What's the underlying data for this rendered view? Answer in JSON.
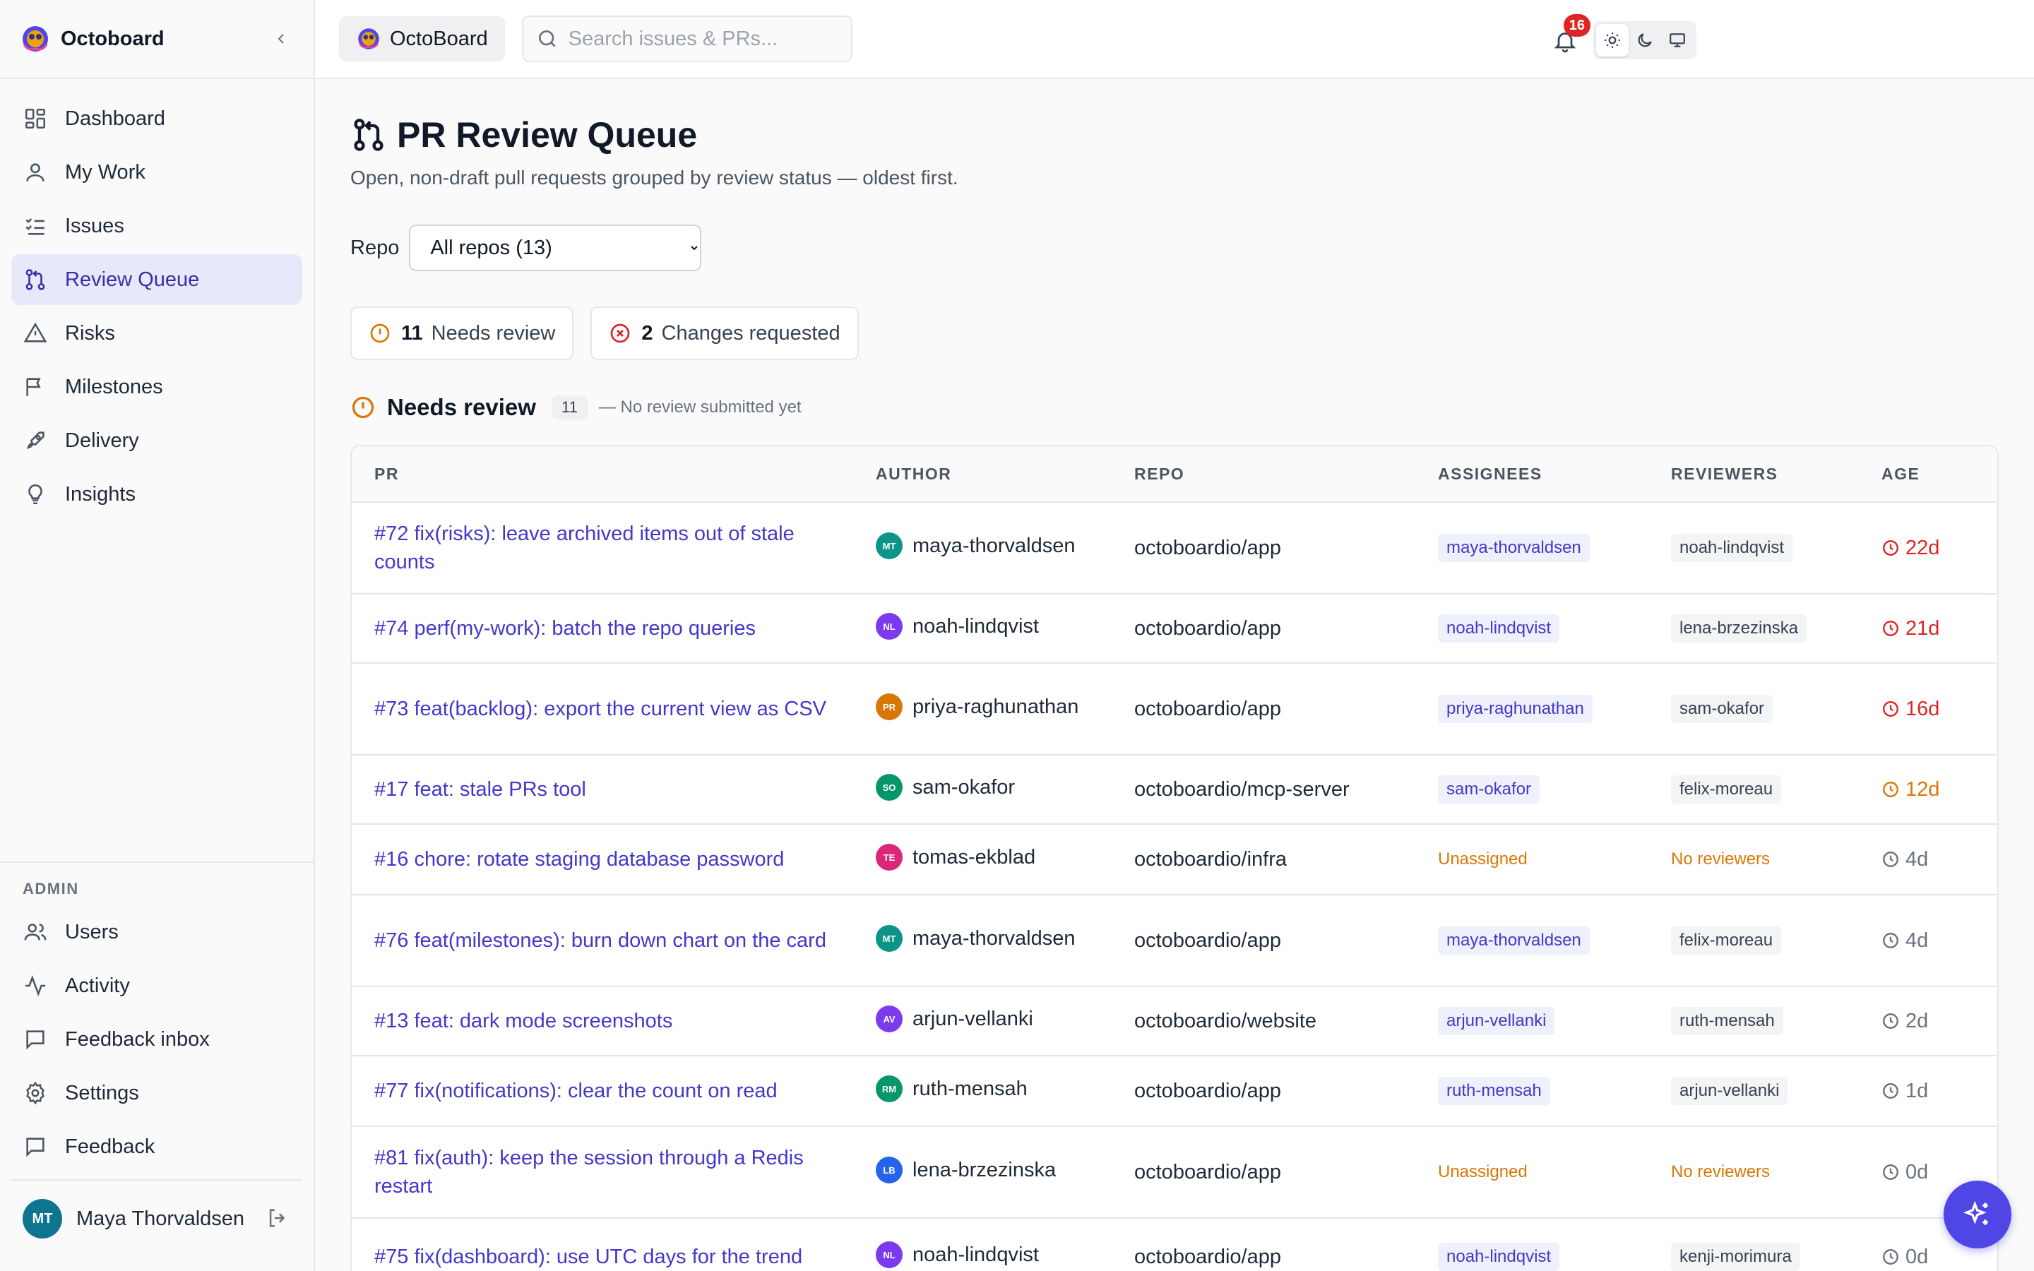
{
  "app": {
    "name": "Octoboard",
    "workspace": "OctoBoard"
  },
  "sidebar": {
    "items": [
      {
        "label": "Dashboard",
        "icon": "grid-icon"
      },
      {
        "label": "My Work",
        "icon": "user-icon"
      },
      {
        "label": "Issues",
        "icon": "list-check-icon"
      },
      {
        "label": "Review Queue",
        "icon": "git-pull-request-icon",
        "active": true
      },
      {
        "label": "Risks",
        "icon": "warning-triangle-icon"
      },
      {
        "label": "Milestones",
        "icon": "flag-icon"
      },
      {
        "label": "Delivery",
        "icon": "rocket-icon"
      },
      {
        "label": "Insights",
        "icon": "lightbulb-icon"
      }
    ],
    "admin_title": "ADMIN",
    "admin_items": [
      {
        "label": "Users",
        "icon": "users-icon"
      },
      {
        "label": "Activity",
        "icon": "activity-icon"
      },
      {
        "label": "Feedback inbox",
        "icon": "message-square-icon"
      },
      {
        "label": "Settings",
        "icon": "gear-icon"
      },
      {
        "label": "Feedback",
        "icon": "message-square-icon"
      }
    ],
    "user": {
      "initials": "MT",
      "name": "Maya Thorvaldsen"
    }
  },
  "topbar": {
    "search_placeholder": "Search issues & PRs...",
    "notification_count": "16"
  },
  "page": {
    "title": "PR Review Queue",
    "subtitle": "Open, non-draft pull requests grouped by review status — oldest first.",
    "repo_label": "Repo",
    "repo_selected": "All repos (13)",
    "stats": [
      {
        "count": "11",
        "label": "Needs review"
      },
      {
        "count": "2",
        "label": "Changes requested"
      }
    ],
    "section": {
      "title": "Needs review",
      "count": "11",
      "note": "— No review submitted yet"
    },
    "columns": [
      "PR",
      "AUTHOR",
      "REPO",
      "ASSIGNEES",
      "REVIEWERS",
      "AGE"
    ]
  },
  "rows": [
    {
      "pr": "#72 fix(risks): leave archived items out of stale counts",
      "initials": "MT",
      "avcolor": "#0d9488",
      "author": "maya-thorvaldsen",
      "repo": "octoboardio/app",
      "assignee": "maya-thorvaldsen",
      "reviewer": "noah-lindqvist",
      "age": "22d",
      "age_level": "red"
    },
    {
      "pr": "#74 perf(my-work): batch the repo queries",
      "initials": "NL",
      "avcolor": "#7c3aed",
      "author": "noah-lindqvist",
      "repo": "octoboardio/app",
      "assignee": "noah-lindqvist",
      "reviewer": "lena-brzezinska",
      "age": "21d",
      "age_level": "red"
    },
    {
      "pr": "#73 feat(backlog): export the current view as CSV",
      "initials": "PR",
      "avcolor": "#d97706",
      "author": "priya-raghunathan",
      "repo": "octoboardio/app",
      "assignee": "priya-raghunathan",
      "reviewer": "sam-okafor",
      "age": "16d",
      "age_level": "red"
    },
    {
      "pr": "#17 feat: stale PRs tool",
      "initials": "SO",
      "avcolor": "#059669",
      "author": "sam-okafor",
      "repo": "octoboardio/mcp-server",
      "assignee": "sam-okafor",
      "reviewer": "felix-moreau",
      "age": "12d",
      "age_level": "amber"
    },
    {
      "pr": "#16 chore: rotate staging database password",
      "initials": "TE",
      "avcolor": "#db2777",
      "author": "tomas-ekblad",
      "repo": "octoboardio/infra",
      "assignee": "",
      "assignee_none": "Unassigned",
      "reviewer": "",
      "reviewer_none": "No reviewers",
      "age": "4d",
      "age_level": "grey"
    },
    {
      "pr": "#76 feat(milestones): burn down chart on the card",
      "initials": "MT",
      "avcolor": "#0d9488",
      "author": "maya-thorvaldsen",
      "repo": "octoboardio/app",
      "assignee": "maya-thorvaldsen",
      "reviewer": "felix-moreau",
      "age": "4d",
      "age_level": "grey"
    },
    {
      "pr": "#13 feat: dark mode screenshots",
      "initials": "AV",
      "avcolor": "#7c3aed",
      "author": "arjun-vellanki",
      "repo": "octoboardio/website",
      "assignee": "arjun-vellanki",
      "reviewer": "ruth-mensah",
      "age": "2d",
      "age_level": "grey"
    },
    {
      "pr": "#77 fix(notifications): clear the count on read",
      "initials": "RM",
      "avcolor": "#059669",
      "author": "ruth-mensah",
      "repo": "octoboardio/app",
      "assignee": "ruth-mensah",
      "reviewer": "arjun-vellanki",
      "age": "1d",
      "age_level": "grey"
    },
    {
      "pr": "#81 fix(auth): keep the session through a Redis restart",
      "initials": "LB",
      "avcolor": "#2563eb",
      "author": "lena-brzezinska",
      "repo": "octoboardio/app",
      "assignee": "",
      "assignee_none": "Unassigned",
      "reviewer": "",
      "reviewer_none": "No reviewers",
      "age": "0d",
      "age_level": "grey"
    },
    {
      "pr": "#75 fix(dashboard): use UTC days for the trend",
      "initials": "NL",
      "avcolor": "#7c3aed",
      "author": "noah-lindqvist",
      "repo": "octoboardio/app",
      "assignee": "noah-lindqvist",
      "reviewer": "kenji-morimura",
      "age": "0d",
      "age_level": "grey"
    }
  ],
  "colors": {
    "accent": "#4338ca",
    "danger": "#dc2626",
    "warning": "#d97706"
  }
}
